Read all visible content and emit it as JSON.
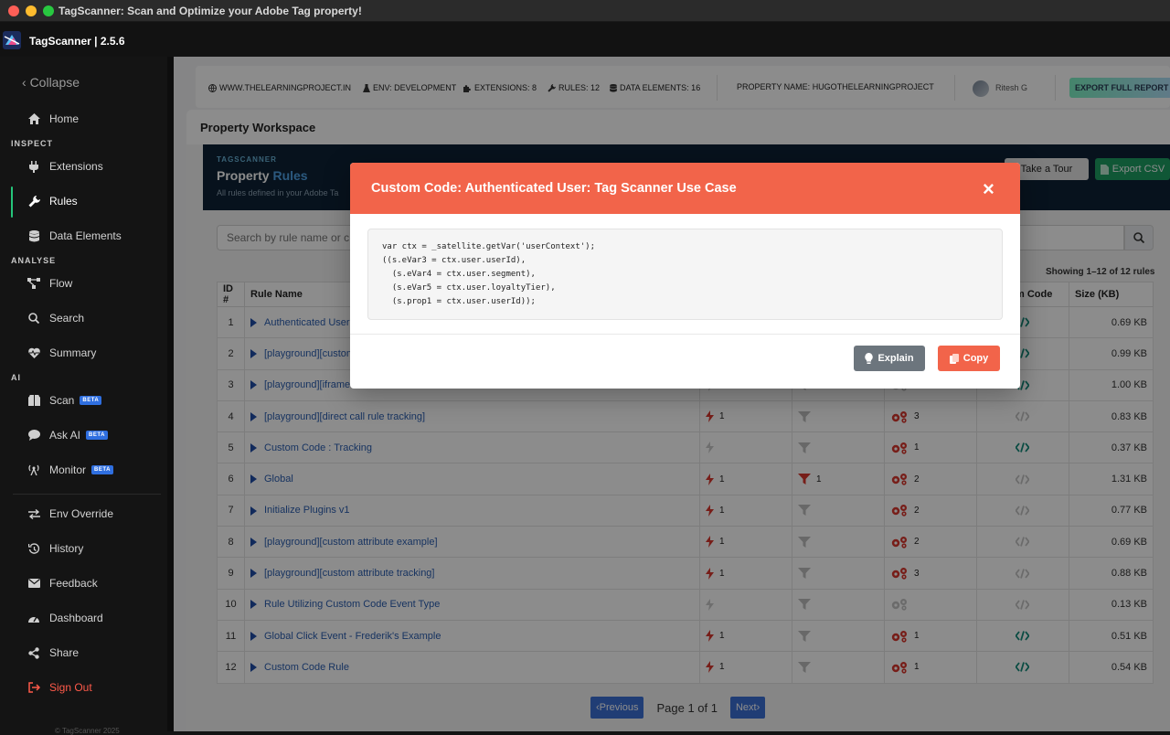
{
  "window": {
    "title": "TagScanner: Scan and Optimize your Adobe Tag property!"
  },
  "app": {
    "name": "TagScanner | 2.5.6"
  },
  "sidebar": {
    "collapse": "Collapse",
    "home": "Home",
    "sections": {
      "inspect": "INSPECT",
      "analyse": "ANALYSE",
      "ai": "AI"
    },
    "items": {
      "extensions": "Extensions",
      "rules": "Rules",
      "data_elements": "Data Elements",
      "flow": "Flow",
      "search": "Search",
      "summary": "Summary",
      "scan": "Scan",
      "ask_ai": "Ask AI",
      "monitor": "Monitor",
      "env_override": "Env Override",
      "history": "History",
      "feedback": "Feedback",
      "dashboard": "Dashboard",
      "share": "Share",
      "sign_out": "Sign Out"
    },
    "beta": "BETA",
    "footer": "© TagScanner 2025"
  },
  "topbar": {
    "site": "WWW.THELEARNINGPROJECT.IN",
    "env": "ENV: DEVELOPMENT",
    "extensions": "EXTENSIONS: 8",
    "rules": "RULES: 12",
    "data_elements": "DATA ELEMENTS: 16",
    "property": "PROPERTY NAME: HUGOTHELEARNINGPROJECT",
    "user": "Ritesh G",
    "export": "EXPORT FULL REPORT (.X"
  },
  "workspace": {
    "title": "Property Workspace",
    "hero_tag": "TAGSCANNER",
    "hero_title_a": "Property ",
    "hero_title_b": "Rules",
    "hero_sub": "All rules defined in your Adobe Ta",
    "tour": "Take a Tour",
    "csv": "Export CSV",
    "search_placeholder": "Search by rule name or c",
    "showing": "Showing 1–12 of 12 rules",
    "headers": {
      "id": "ID #",
      "name": "Rule Name",
      "code": "m Code",
      "size": "Size (KB)"
    },
    "rows": [
      {
        "id": "1",
        "name": "Authenticated User: ",
        "ev": "",
        "cond": "",
        "act": "",
        "size": "0.69 KB"
      },
      {
        "id": "2",
        "name": "[playground][custom ",
        "ev": "",
        "cond": "",
        "act": "",
        "size": "0.99 KB"
      },
      {
        "id": "3",
        "name": "[playground][iframe t",
        "ev": "",
        "cond": "",
        "act": "",
        "size": "1.00 KB"
      },
      {
        "id": "4",
        "name": "[playground][direct call rule tracking]",
        "ev": "1",
        "cond": "",
        "act": "3",
        "size": "0.83 KB"
      },
      {
        "id": "5",
        "name": "Custom Code : Tracking",
        "ev": "",
        "cond": "",
        "act": "1",
        "size": "0.37 KB"
      },
      {
        "id": "6",
        "name": "Global",
        "ev": "1",
        "cond": "1",
        "act": "2",
        "size": "1.31 KB"
      },
      {
        "id": "7",
        "name": "Initialize Plugins v1",
        "ev": "1",
        "cond": "",
        "act": "2",
        "size": "0.77 KB"
      },
      {
        "id": "8",
        "name": "[playground][custom attribute example]",
        "ev": "1",
        "cond": "",
        "act": "2",
        "size": "0.69 KB"
      },
      {
        "id": "9",
        "name": "[playground][custom attribute tracking]",
        "ev": "1",
        "cond": "",
        "act": "3",
        "size": "0.88 KB"
      },
      {
        "id": "10",
        "name": "Rule Utilizing Custom Code Event Type",
        "ev": "",
        "cond": "",
        "act": "",
        "size": "0.13 KB"
      },
      {
        "id": "11",
        "name": "Global Click Event - Frederik's Example",
        "ev": "1",
        "cond": "",
        "act": "1",
        "size": "0.51 KB"
      },
      {
        "id": "12",
        "name": "Custom Code Rule",
        "ev": "1",
        "cond": "",
        "act": "1",
        "size": "0.54 KB"
      }
    ],
    "pager": {
      "prev": "Previous",
      "page": "Page 1 of 1",
      "next": "Next"
    }
  },
  "modal": {
    "title": "Custom Code: Authenticated User: Tag Scanner Use Case",
    "close": "×",
    "code": "var ctx = _satellite.getVar('userContext');\n((s.eVar3 = ctx.user.userId),\n  (s.eVar4 = ctx.user.segment),\n  (s.eVar5 = ctx.user.loyaltyTier),\n  (s.prop1 = ctx.user.userId));",
    "explain": "Explain",
    "copy": "Copy"
  }
}
